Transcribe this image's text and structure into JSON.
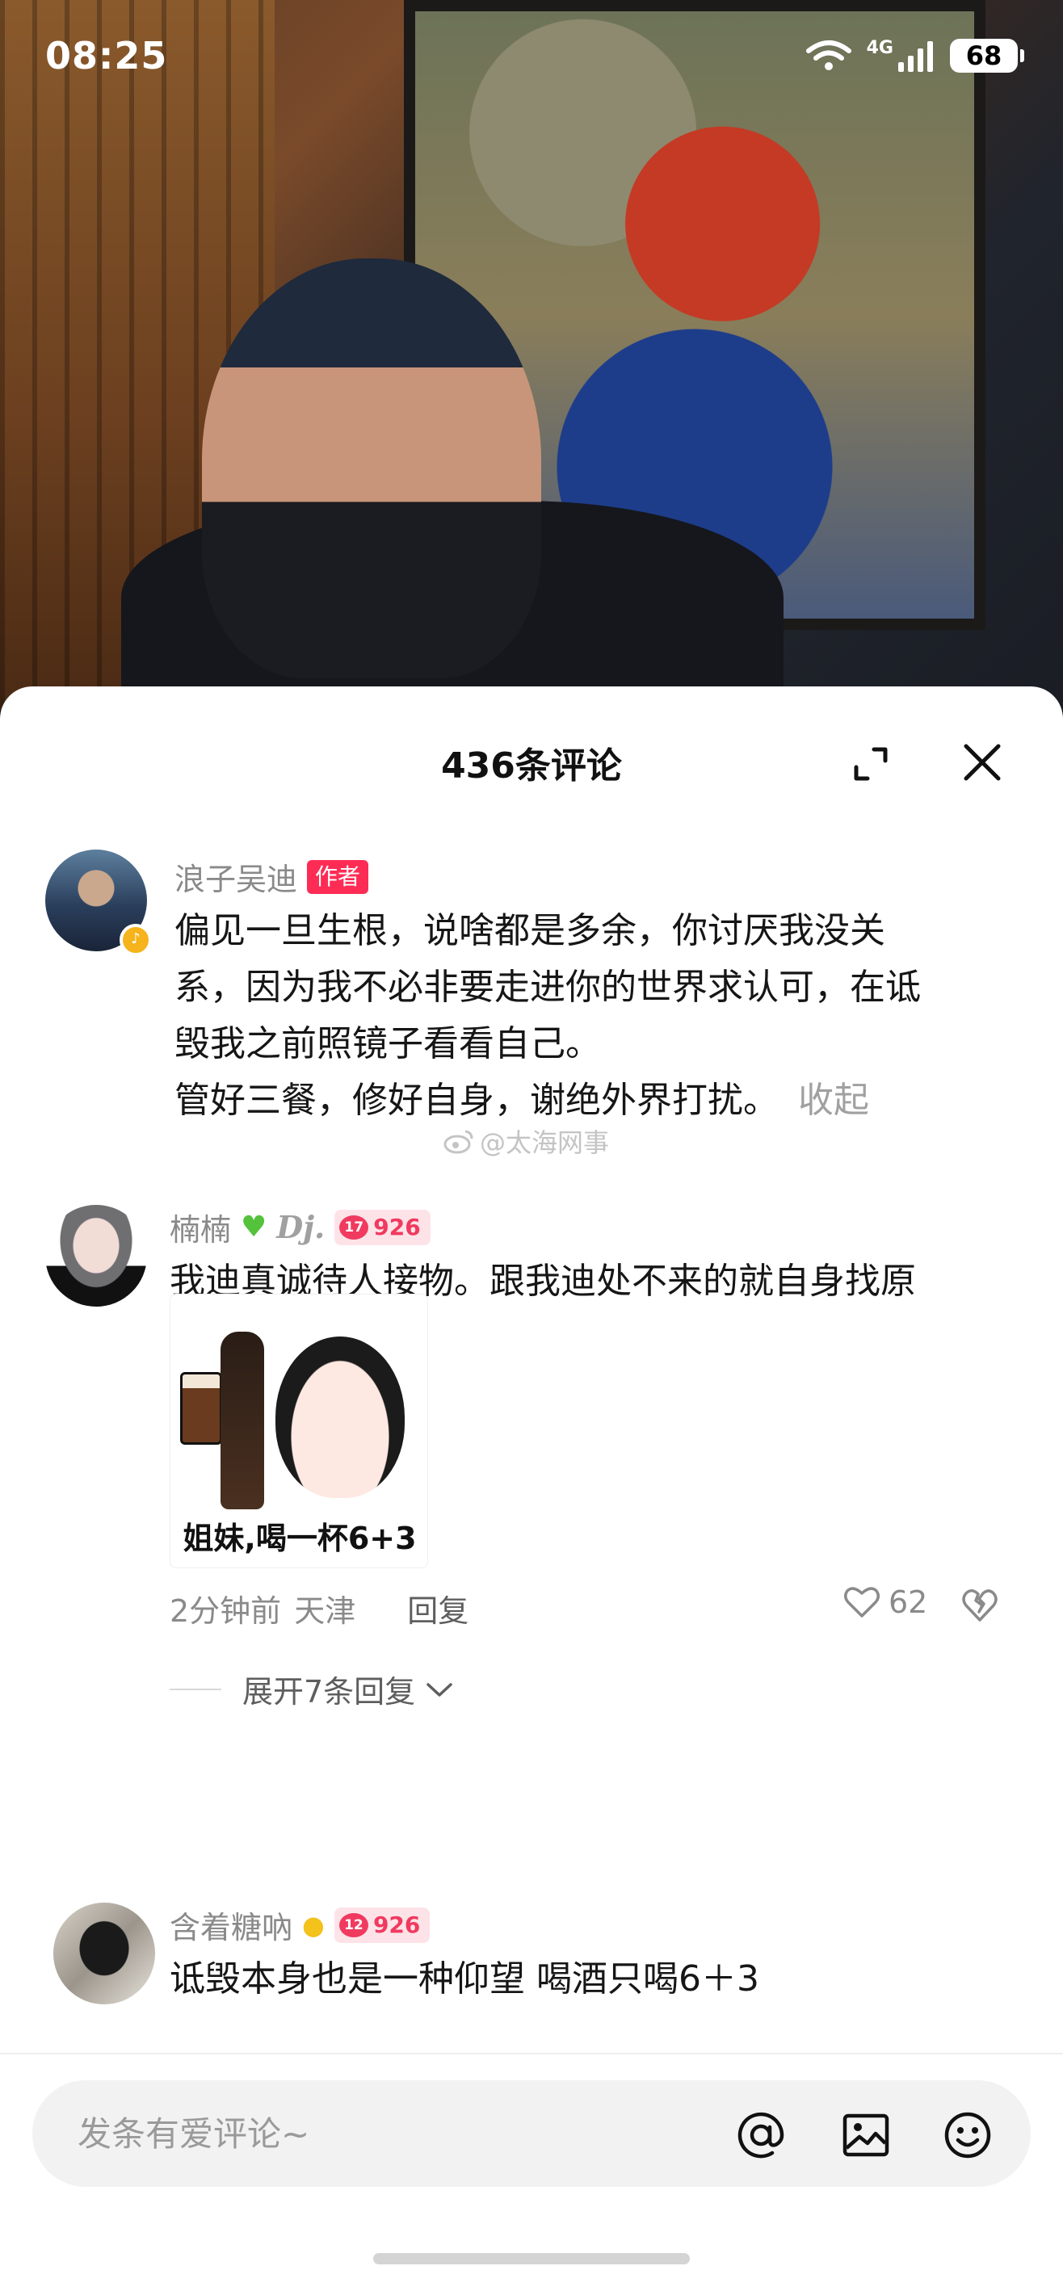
{
  "status_bar": {
    "time": "08:25",
    "network": "4G",
    "battery": "68"
  },
  "comments_panel": {
    "title": "436条评论",
    "comments": [
      {
        "username": "浪子吴迪",
        "tag": "作者",
        "text": "偏见一旦生根，说啥都是多余，你讨厌我没关\n系，因为我不必非要走进你的世界求认可，在诋\n毁我之前照镜子看看自己。\n管好三餐，修好自身，谢绝外界打扰。",
        "collapse": "收起"
      },
      {
        "username": "楠楠",
        "username_suffix": "Dj.",
        "fan_level": "17",
        "fan_count": "926",
        "text": "我迪真诚待人接物。跟我迪处不来的就自身找原\n因吧",
        "sticker_caption": "姐妹,喝一杯6+3",
        "time": "2分钟前",
        "location": "天津",
        "reply": "回复",
        "likes": "62",
        "expand_replies": "展开7条回复"
      },
      {
        "username": "含着糖吶",
        "fan_level": "12",
        "fan_count": "926",
        "text": "诋毁本身也是一种仰望 喝酒只喝6＋3"
      }
    ]
  },
  "watermark": "@太海网事",
  "input": {
    "placeholder": "发条有爱评论~"
  },
  "icons": {
    "expand": "expand-icon",
    "close": "close-icon",
    "like": "heart-outline-icon",
    "dislike": "broken-heart-icon",
    "at": "at-icon",
    "image": "image-icon",
    "emoji": "smiley-icon"
  },
  "colors": {
    "author_tag": "#fe2c55",
    "fan_badge_bg": "#fde3e8",
    "fan_badge_text": "#f03a5f"
  }
}
